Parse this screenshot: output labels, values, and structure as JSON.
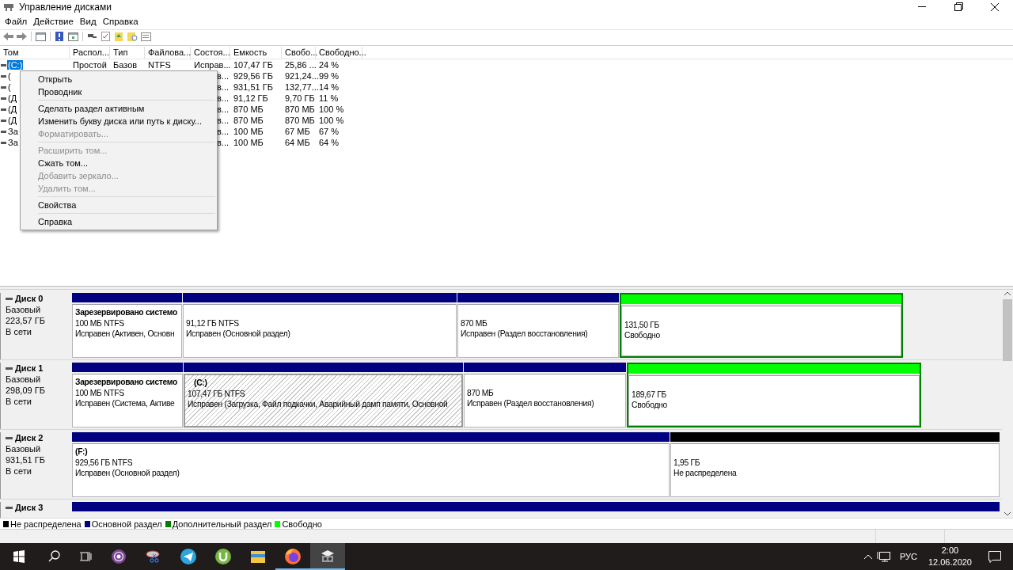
{
  "window": {
    "title": "Управление дисками"
  },
  "menu_bar": [
    "Файл",
    "Действие",
    "Вид",
    "Справка"
  ],
  "volume_list": {
    "columns": [
      "Том",
      "Распол...",
      "Тип",
      "Файлова...",
      "Состоя...",
      "Емкость",
      "Свобо...",
      "Свободно..."
    ],
    "rows": [
      {
        "cells": [
          "(C:)",
          "Простой",
          "Базов",
          "NTFS",
          "Исправ...",
          "107,47 ГБ",
          "25,86 ...",
          "24 %"
        ],
        "selected": true
      },
      {
        "cells": [
          "(",
          null,
          null,
          null,
          "в...",
          "929,56 ГБ",
          "921,24...",
          "99 %"
        ],
        "selected": false
      },
      {
        "cells": [
          "(",
          null,
          null,
          null,
          "в...",
          "931,51 ГБ",
          "132,77...",
          "14 %"
        ],
        "selected": false
      },
      {
        "cells": [
          "(Д",
          null,
          null,
          null,
          "в...",
          "91,12 ГБ",
          "9,70 ГБ",
          "11 %"
        ],
        "selected": false
      },
      {
        "cells": [
          "(Д",
          null,
          null,
          null,
          "в...",
          "870 МБ",
          "870 МБ",
          "100 %"
        ],
        "selected": false
      },
      {
        "cells": [
          "(Д",
          null,
          null,
          null,
          "в...",
          "870 МБ",
          "870 МБ",
          "100 %"
        ],
        "selected": false
      },
      {
        "cells": [
          "За",
          null,
          null,
          null,
          "в...",
          "100 МБ",
          "67 МБ",
          "67 %"
        ],
        "selected": false
      },
      {
        "cells": [
          "За",
          null,
          null,
          null,
          "в...",
          "100 МБ",
          "64 МБ",
          "64 %"
        ],
        "selected": false
      }
    ]
  },
  "context_menu": {
    "groups": [
      {
        "items": [
          {
            "label": "Открыть",
            "disabled": false
          },
          {
            "label": "Проводник",
            "disabled": false
          }
        ]
      },
      {
        "items": [
          {
            "label": "Сделать раздел активным",
            "disabled": false
          },
          {
            "label": "Изменить букву диска или путь к диску...",
            "disabled": false
          },
          {
            "label": "Форматировать...",
            "disabled": true
          }
        ]
      },
      {
        "items": [
          {
            "label": "Расширить том...",
            "disabled": true
          },
          {
            "label": "Сжать том...",
            "disabled": false
          },
          {
            "label": "Добавить зеркало...",
            "disabled": true
          },
          {
            "label": "Удалить том...",
            "disabled": true
          }
        ]
      },
      {
        "items": [
          {
            "label": "Свойства",
            "disabled": false
          }
        ]
      },
      {
        "items": [
          {
            "label": "Справка",
            "disabled": false
          }
        ]
      }
    ]
  },
  "disks": [
    {
      "name": "Диск 0",
      "type": "Базовый",
      "size": "223,57 ГБ",
      "state": "В сети",
      "partitions": [
        {
          "kind": "primary",
          "name": "Зарезервировано системо",
          "size": "100 МБ NTFS",
          "status": "Исправен (Активен, Основн",
          "selected": false
        },
        {
          "kind": "primary",
          "size": "91,12 ГБ NTFS",
          "status": "Исправен (Основной раздел)",
          "selected": false
        },
        {
          "kind": "primary",
          "size": "870 МБ",
          "status": "Исправен (Раздел восстановления)",
          "selected": false
        },
        {
          "kind": "free",
          "size": "131,50 ГБ",
          "status": "Свободно",
          "selected": false
        }
      ]
    },
    {
      "name": "Диск 1",
      "type": "Базовый",
      "size": "298,09 ГБ",
      "state": "В сети",
      "partitions": [
        {
          "kind": "primary",
          "name": "Зарезервировано системо",
          "size": "100 МБ NTFS",
          "status": "Исправен (Система, Активе",
          "selected": false
        },
        {
          "kind": "primary",
          "name": "(C:)",
          "size": "107,47 ГБ NTFS",
          "status": "Исправен (Загрузка, Файл подкачки, Аварийный дамп памяти, Основной",
          "selected": true
        },
        {
          "kind": "primary",
          "size": "870 МБ",
          "status": "Исправен (Раздел восстановления)",
          "selected": false
        },
        {
          "kind": "free",
          "size": "189,67 ГБ",
          "status": "Свободно",
          "selected": false
        }
      ]
    },
    {
      "name": "Диск 2",
      "type": "Базовый",
      "size": "931,51 ГБ",
      "state": "В сети",
      "partitions": [
        {
          "kind": "primary",
          "name": "(F:)",
          "size": "929,56 ГБ NTFS",
          "status": "Исправен (Основной раздел)",
          "selected": false
        },
        {
          "kind": "unallocated",
          "size": "1,95 ГБ",
          "status": "Не распределена",
          "selected": false
        }
      ]
    },
    {
      "name": "Диск 3",
      "partitions": [
        {
          "kind": "primary"
        }
      ]
    }
  ],
  "legend": [
    {
      "label": "Не распределена",
      "color": "#000000"
    },
    {
      "label": "Основной раздел",
      "color": "#000080"
    },
    {
      "label": "Дополнительный раздел",
      "color": "#008000"
    },
    {
      "label": "Свободно",
      "color": "#00ff00"
    }
  ],
  "taskbar": {
    "apps": [
      {
        "running": false,
        "selected": false
      },
      {
        "running": false,
        "selected": false
      },
      {
        "running": false,
        "selected": false
      },
      {
        "running": false,
        "selected": false
      },
      {
        "running": false,
        "selected": false
      },
      {
        "running": true,
        "selected": false
      },
      {
        "running": true,
        "selected": true
      }
    ],
    "language": "РУС",
    "time": "2:00",
    "date": "12.06.2020"
  }
}
